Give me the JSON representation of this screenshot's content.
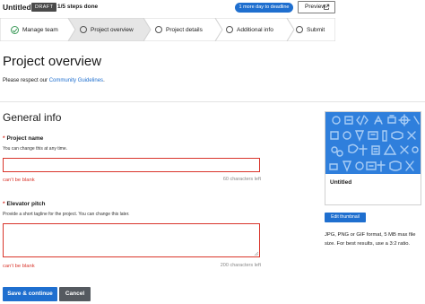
{
  "header": {
    "project_name": "Untitled",
    "status_badge": "DRAFT",
    "progress_text": "1/5 steps done",
    "deadline_badge": "1 more day to deadline",
    "preview_label": "Preview",
    "preview_icon": "external-link-icon"
  },
  "stepper": {
    "steps": [
      {
        "label": "Manage team",
        "state": "done"
      },
      {
        "label": "Project overview",
        "state": "current"
      },
      {
        "label": "Project details",
        "state": "todo"
      },
      {
        "label": "Additional info",
        "state": "todo"
      },
      {
        "label": "Submit",
        "state": "todo"
      }
    ]
  },
  "page": {
    "title": "Project overview",
    "guideline_prefix": "Please respect our ",
    "guideline_link": "Community Guidelines",
    "guideline_suffix": "."
  },
  "general_info": {
    "title": "General info",
    "project_name_field": {
      "required_mark": "*",
      "label": "Project name",
      "help": "You can change this at any time.",
      "value": "",
      "error": "can't be blank",
      "counter": "60 characters left"
    },
    "elevator_pitch_field": {
      "required_mark": "*",
      "label": "Elevator pitch",
      "help": "Provide a short tagline for the project. You can change this later.",
      "value": "",
      "error": "can't be blank",
      "counter": "200 characters left"
    }
  },
  "actions": {
    "save_label": "Save & continue",
    "cancel_label": "Cancel"
  },
  "thumbnail": {
    "title": "Untitled",
    "edit_label": "Edit thumbnail",
    "help": "JPG, PNG or GIF format, 5 MB max file size. For best results, use a 3:2 ratio."
  },
  "colors": {
    "accent": "#1f6fcf",
    "error": "#d9352b",
    "success": "#3d9b5b",
    "thumb_bg": "#2f7fdc"
  }
}
